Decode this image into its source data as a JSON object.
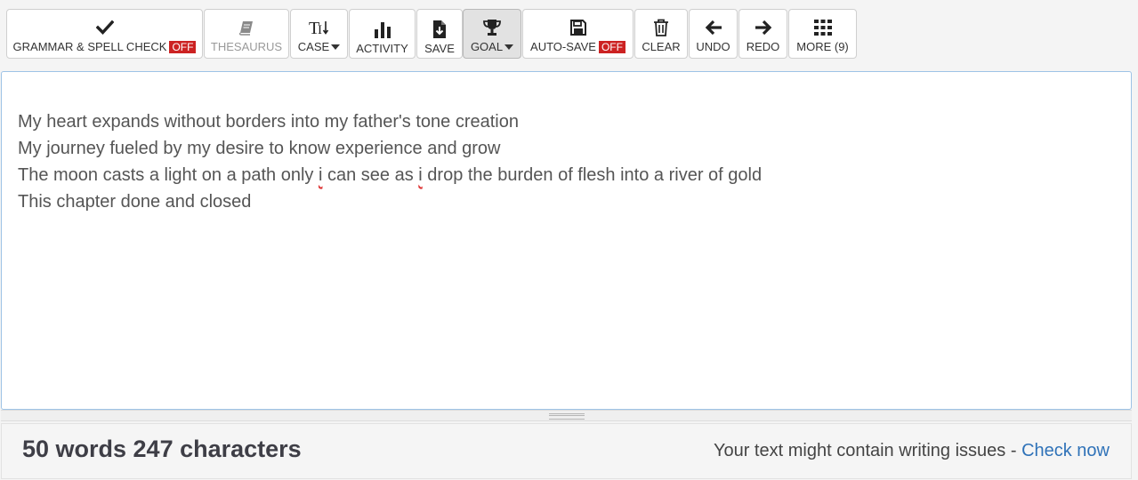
{
  "toolbar": {
    "grammar": {
      "label": "GRAMMAR & SPELL CHECK",
      "badge": "OFF",
      "icon": "check-icon"
    },
    "thesaurus": {
      "label": "THESAURUS",
      "icon": "book-icon"
    },
    "case": {
      "label": "CASE",
      "icon": "text-case-icon"
    },
    "activity": {
      "label": "ACTIVITY",
      "icon": "bar-chart-icon"
    },
    "save": {
      "label": "SAVE",
      "icon": "save-file-icon"
    },
    "goal": {
      "label": "GOAL",
      "icon": "trophy-icon"
    },
    "autosave": {
      "label": "AUTO-SAVE",
      "badge": "OFF",
      "icon": "floppy-icon"
    },
    "clear": {
      "label": "CLEAR",
      "icon": "trash-icon"
    },
    "undo": {
      "label": "UNDO",
      "icon": "arrow-left-icon"
    },
    "redo": {
      "label": "REDO",
      "icon": "arrow-right-icon"
    },
    "more": {
      "label": "MORE (9)",
      "icon": "grid-icon"
    }
  },
  "editor": {
    "lines": [
      "My heart expands without borders into my father's tone creation",
      "My journey fueled by my desire to know experience and grow",
      {
        "before": "The moon casts a light on a path only ",
        "word1": "i",
        "middle": " can see as ",
        "word2": "i",
        "after": " drop the burden of flesh into a river of gold"
      },
      "This chapter done and closed"
    ]
  },
  "footer": {
    "counts": "50 words 247 characters",
    "issues_text": "Your text might contain writing issues - ",
    "check_link": "Check now"
  },
  "colors": {
    "badge_off": "#cc2222",
    "link": "#2f72b8",
    "editor_border": "#9ec3e6"
  }
}
